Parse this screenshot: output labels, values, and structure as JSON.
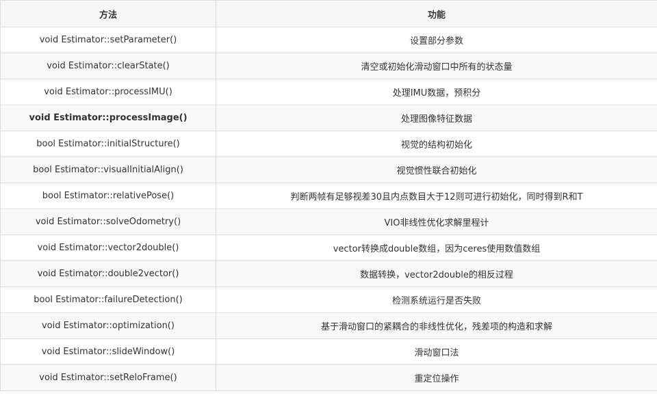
{
  "table": {
    "headers": [
      "方法",
      "功能"
    ],
    "rows": [
      {
        "method": "void Estimator::setParameter()",
        "function": "设置部分参数",
        "bold": false
      },
      {
        "method": "void Estimator::clearState()",
        "function": "清空或初始化滑动窗口中所有的状态量",
        "bold": false
      },
      {
        "method": "void Estimator::processIMU()",
        "function": "处理IMU数据，预积分",
        "bold": false
      },
      {
        "method": "void Estimator::processImage()",
        "function": "处理图像特征数据",
        "bold": true
      },
      {
        "method": "bool Estimator::initialStructure()",
        "function": "视觉的结构初始化",
        "bold": false
      },
      {
        "method": "bool Estimator::visualInitialAlign()",
        "function": "视觉惯性联合初始化",
        "bold": false
      },
      {
        "method": "bool Estimator::relativePose()",
        "function": "判断两帧有足够视差30且内点数目大于12则可进行初始化，同时得到R和T",
        "bold": false
      },
      {
        "method": "void Estimator::solveOdometry()",
        "function": "VIO非线性优化求解里程计",
        "bold": false
      },
      {
        "method": "void Estimator::vector2double()",
        "function": "vector转换成double数组，因为ceres使用数值数组",
        "bold": false
      },
      {
        "method": "void Estimator::double2vector()",
        "function": "数据转换，vector2double的相反过程",
        "bold": false
      },
      {
        "method": "bool Estimator::failureDetection()",
        "function": "检测系统运行是否失败",
        "bold": false
      },
      {
        "method": "void Estimator::optimization()",
        "function": "基于滑动窗口的紧耦合的非线性优化，残差项的构造和求解",
        "bold": false
      },
      {
        "method": "void Estimator::slideWindow()",
        "function": "滑动窗口法",
        "bold": false
      },
      {
        "method": "void Estimator::setReloFrame()",
        "function": "重定位操作",
        "bold": false
      }
    ]
  }
}
